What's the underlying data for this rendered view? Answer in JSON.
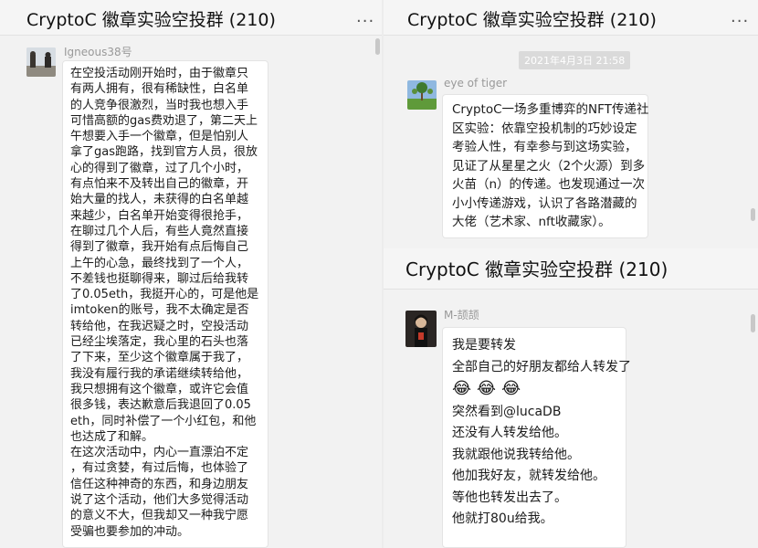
{
  "colors": {
    "bubble": "#ffffff",
    "background": "#f2f2f2",
    "timestamp": "#dadada"
  },
  "panels": [
    {
      "title": "CryptoC 徽章实验空投群 (210)",
      "menu": "...",
      "sender": "Igneous38号",
      "lines": [
        "在空投活动刚开始时，由于徽章只",
        "有两人拥有，很有稀缺性，白名单",
        "的人竞争很激烈，当时我也想入手",
        "可惜高额的gas费劝退了，第二天上",
        "午想要入手一个徽章，但是怕别人",
        "拿了gas跑路，找到官方人员，很放",
        "心的得到了徽章，过了几个小时，",
        "有点怕来不及转出自己的徽章，开",
        "始大量的找人，未获得的白名单越",
        "来越少，白名单开始变得很抢手，",
        "在聊过几个人后，有些人竟然直接",
        "得到了徽章，我开始有点后悔自己",
        "上午的心急，最终找到了一个人，",
        "不差钱也挺聊得来，聊过后给我转",
        "了0.05eth，我挺开心的，可是他是",
        "imtoken的账号，我不太确定是否",
        "转给他，在我迟疑之时，空投活动",
        "已经尘埃落定，我心里的石头也落",
        "了下来，至少这个徽章属于我了，",
        "我没有履行我的承诺继续转给他，",
        "我只想拥有这个徽章，或许它会值",
        "很多钱，表达歉意后我退回了0.05",
        "eth，同时补偿了一个小红包，和他",
        "也达成了和解。",
        "在这次活动中，内心一直漂泊不定",
        "，有过贪婪，有过后悔，也体验了",
        "信任这种神奇的东西，和身边朋友",
        "说了这个活动，他们大多觉得活动",
        "的意义不大，但我却又一种我宁愿",
        "受骗也要参加的冲动。"
      ]
    },
    {
      "title": "CryptoC 徽章实验空投群 (210)",
      "menu": "...",
      "timestamp": "2021年4月3日 21:58",
      "sender": "eye of tiger",
      "lines": [
        "CryptoC一场多重博弈的NFT传递社",
        "区实验：依靠空投机制的巧妙设定",
        "考验人性，有幸参与到这场实验，",
        "见证了从星星之火（2个火源）到多",
        "火苗（n）的传递。也发现通过一次",
        "小小传递游戏，认识了各路潜藏的",
        "大佬（艺术家、nft收藏家）。"
      ]
    },
    {
      "title": "CryptoC 徽章实验空投群 (210)",
      "sender": "M-颉颉",
      "lines_before": [
        "我是要转发",
        "全部自己的好朋友都给人转发了"
      ],
      "emojis": [
        "😂",
        "😂",
        "😂"
      ],
      "lines_after": [
        "突然看到@lucaDB",
        "还没有人转发给他。",
        "我就跟他说我转给他。",
        "他加我好友，就转发给他。",
        "等他也转发出去了。",
        "他就打80u给我。"
      ]
    }
  ]
}
